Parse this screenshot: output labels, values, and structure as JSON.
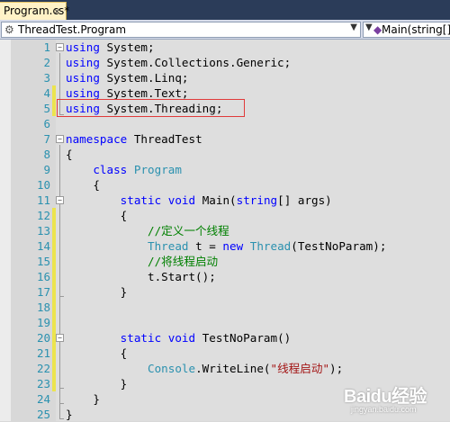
{
  "tab": {
    "title": "Program.cs*",
    "close": "×"
  },
  "navbar": {
    "class_combo": "ThreadTest.Program",
    "member_combo": "Main(string[] arg"
  },
  "editor": {
    "line_numbers": [
      "1",
      "2",
      "3",
      "4",
      "5",
      "6",
      "7",
      "8",
      "9",
      "10",
      "11",
      "12",
      "13",
      "14",
      "15",
      "16",
      "17",
      "18",
      "19",
      "20",
      "21",
      "22",
      "23",
      "24",
      "25"
    ],
    "lines": {
      "l1": [
        "using",
        " System;"
      ],
      "l2": [
        "using",
        " System.Collections.Generic;"
      ],
      "l3": [
        "using",
        " System.Linq;"
      ],
      "l4": [
        "using",
        " System.Text;"
      ],
      "l5": [
        "using",
        " System.Threading;"
      ],
      "l7": [
        "namespace",
        " ThreadTest"
      ],
      "l8": "{",
      "l9": [
        "    ",
        "class",
        " ",
        "Program"
      ],
      "l10": "    {",
      "l11": [
        "        ",
        "static",
        " ",
        "void",
        " Main(",
        "string",
        "[] args)"
      ],
      "l12": "        {",
      "l13": [
        "            ",
        "//定义一个线程"
      ],
      "l14": [
        "            ",
        "Thread",
        " t = ",
        "new",
        " ",
        "Thread",
        "(TestNoParam);"
      ],
      "l15": [
        "            ",
        "//将线程启动"
      ],
      "l16": "            t.Start();",
      "l17": "        }",
      "l20": [
        "        ",
        "static",
        " ",
        "void",
        " TestNoParam()"
      ],
      "l21": "        {",
      "l22": [
        "            ",
        "Console",
        ".WriteLine(",
        "\"线程启动\"",
        ");"
      ],
      "l23": "        }",
      "l24": "    }",
      "l25": "}"
    }
  },
  "watermark": {
    "brand": "Baidu经验",
    "url": "jingyan.baidu.com"
  }
}
